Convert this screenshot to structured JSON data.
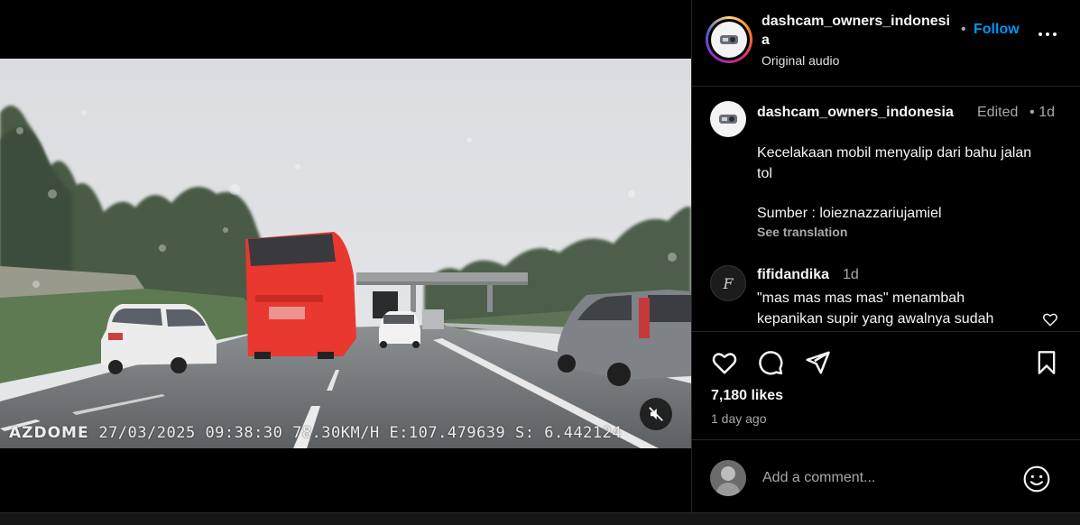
{
  "post": {
    "author": "dashcam_owners_indonesia",
    "follow_label": "Follow",
    "separator": "•",
    "audio": "Original audio",
    "caption": {
      "username": "dashcam_owners_indonesia",
      "edited": "Edited",
      "separator": "•",
      "time": "1d",
      "text": "Kecelakaan mobil menyalip dari bahu jalan tol",
      "source": "Sumber : loieznazzariujamiel",
      "translate": "See translation"
    },
    "comment": {
      "username": "fifidandika",
      "time": "1d",
      "text": "\"mas mas mas mas\" menambah kepanikan supir yang awalnya sudah",
      "avatar_letter": "F"
    },
    "likes": "7,180 likes",
    "posted": "1 day ago",
    "add_comment_placeholder": "Add a comment..."
  },
  "video": {
    "overlay": {
      "brand": "AZDOME",
      "date": "27/03/2025",
      "time": "09:38:30",
      "speed": "78.30KM/H",
      "east": "E:107.479639",
      "south": "S: 6.442124"
    },
    "muted": true
  },
  "icons": {
    "more": "more-horizontal-icon",
    "like": "heart-icon",
    "comment": "comment-icon",
    "share": "send-icon",
    "save": "bookmark-icon",
    "emoji": "emoji-icon",
    "mute": "speaker-muted-icon"
  },
  "colors": {
    "follow": "#0095f6",
    "bus": "#e8382f",
    "background": "#000000"
  }
}
